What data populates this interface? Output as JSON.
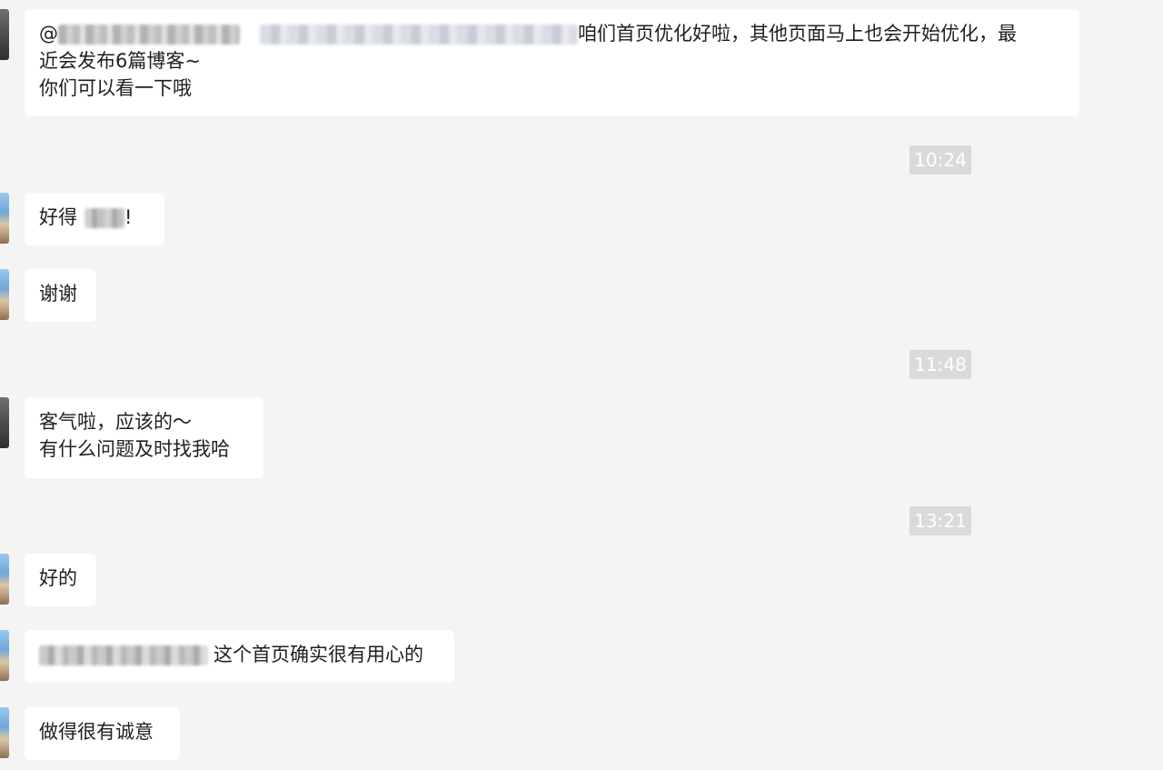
{
  "chat": {
    "messages": [
      {
        "lines": [
          "咱们首页优化好啦，其他页面马上也会开始优化，最",
          "近会发布6篇博客~",
          "你们可以看一下哦"
        ],
        "mention_prefix": "@"
      },
      {
        "text": "好得",
        "suffix": "!"
      },
      {
        "text": "谢谢"
      },
      {
        "lines": [
          "客气啦，应该的～",
          "有什么问题及时找我哈"
        ]
      },
      {
        "text": "好的"
      },
      {
        "text": "这个首页确实很有用心的"
      },
      {
        "text": "做得很有诚意"
      }
    ],
    "timestamps": [
      "10:24",
      "11:48",
      "13:21"
    ]
  },
  "colors": {
    "background": "#f4f4f4",
    "bubble": "#ffffff",
    "timestamp_bg": "#dadada",
    "timestamp_text": "#ffffff"
  }
}
